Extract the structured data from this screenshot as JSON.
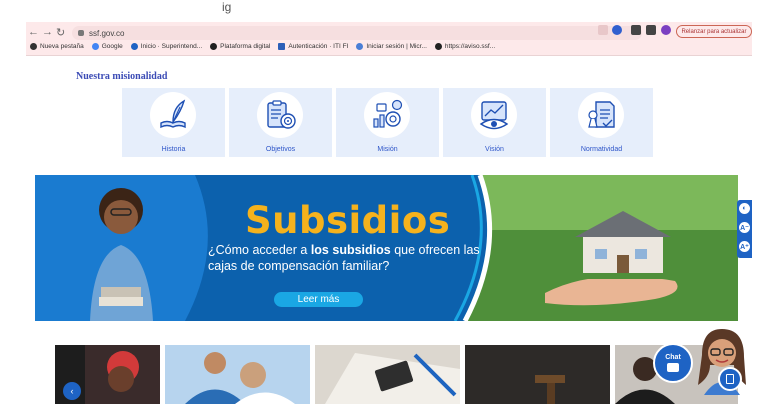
{
  "top_fragment": "ig",
  "browser": {
    "url": "ssf.gov.co",
    "update_label": "Relanzar para actualizar",
    "bookmarks": [
      {
        "label": "Nueva pestaña",
        "icon": "chrome-icon",
        "color": "#333333"
      },
      {
        "label": "Google",
        "icon": "google-icon",
        "color": "#4285f4"
      },
      {
        "label": "Inicio · Superintend...",
        "icon": "ssf-icon",
        "color": "#1e63c4"
      },
      {
        "label": "Plataforma digital",
        "icon": "github-icon",
        "color": "#222222"
      },
      {
        "label": "Autenticación · ITI FI",
        "icon": "app-icon",
        "color": "#2b5fb8"
      },
      {
        "label": "Iniciar sesión | Micr...",
        "icon": "microsoft-icon",
        "color": "#4a7fd6"
      },
      {
        "label": "https://aviso.ssf...",
        "icon": "github-icon",
        "color": "#222222"
      }
    ]
  },
  "section": {
    "title": "Nuestra misionalidad",
    "cards": [
      {
        "label": "Historia",
        "icon": "quill-book-icon"
      },
      {
        "label": "Objetivos",
        "icon": "clipboard-target-icon"
      },
      {
        "label": "Misión",
        "icon": "mission-chart-icon"
      },
      {
        "label": "Visión",
        "icon": "eye-trend-icon"
      },
      {
        "label": "Normatividad",
        "icon": "document-stamp-icon"
      }
    ]
  },
  "banner": {
    "title": "Subsidios",
    "subtitle_pre": "¿Cómo acceder a ",
    "subtitle_bold": "los subsidios",
    "subtitle_post": " que ofrecen las cajas de compensación familiar?",
    "cta": "Leer más",
    "colors": {
      "bg": "#0c61ad",
      "title": "#f5b21d",
      "cta": "#1aa7e4"
    }
  },
  "accessibility": {
    "items": [
      {
        "icon": "contrast-icon",
        "label": ""
      },
      {
        "icon": "font-decrease-icon",
        "label": "A⁻"
      },
      {
        "icon": "font-increase-icon",
        "label": "A⁺"
      }
    ]
  },
  "chat": {
    "label": "Chat"
  }
}
